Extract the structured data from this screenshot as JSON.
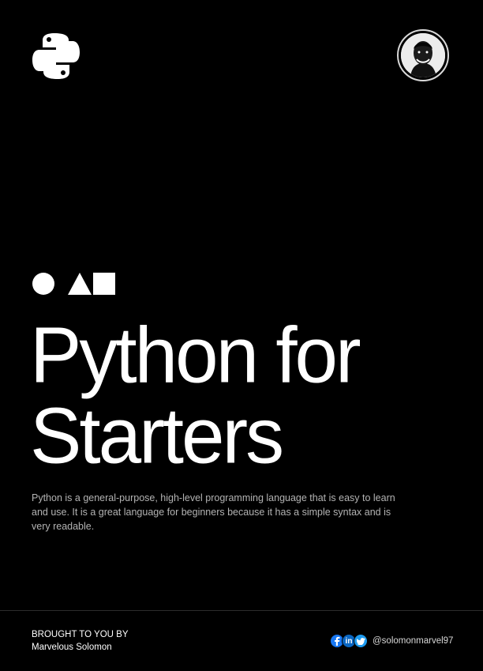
{
  "brand": {
    "logo_icon": "python-logo-icon",
    "avatar_icon": "author-avatar-icon"
  },
  "hero": {
    "shapes": [
      "circle-icon",
      "triangle-icon",
      "square-icon"
    ],
    "title_line_1": "Python for",
    "title_line_2": "Starters",
    "description": "Python is a general-purpose, high-level programming language that is easy to learn and use. It is a great language for beginners because it has a simple syntax and is very readable."
  },
  "footer": {
    "credit_heading": "BROUGHT TO YOU BY",
    "credit_name": "Marvelous Solomon",
    "social_icons": [
      "facebook-icon",
      "linkedin-icon",
      "twitter-icon"
    ],
    "linkedin_text": "in",
    "handle": "@solomonmarvel97"
  },
  "colors": {
    "background": "#000000",
    "text": "#ffffff",
    "muted_text": "#b3b3b3",
    "facebook": "#1877f2",
    "linkedin": "#0a66c2",
    "twitter": "#1d9bf0"
  }
}
